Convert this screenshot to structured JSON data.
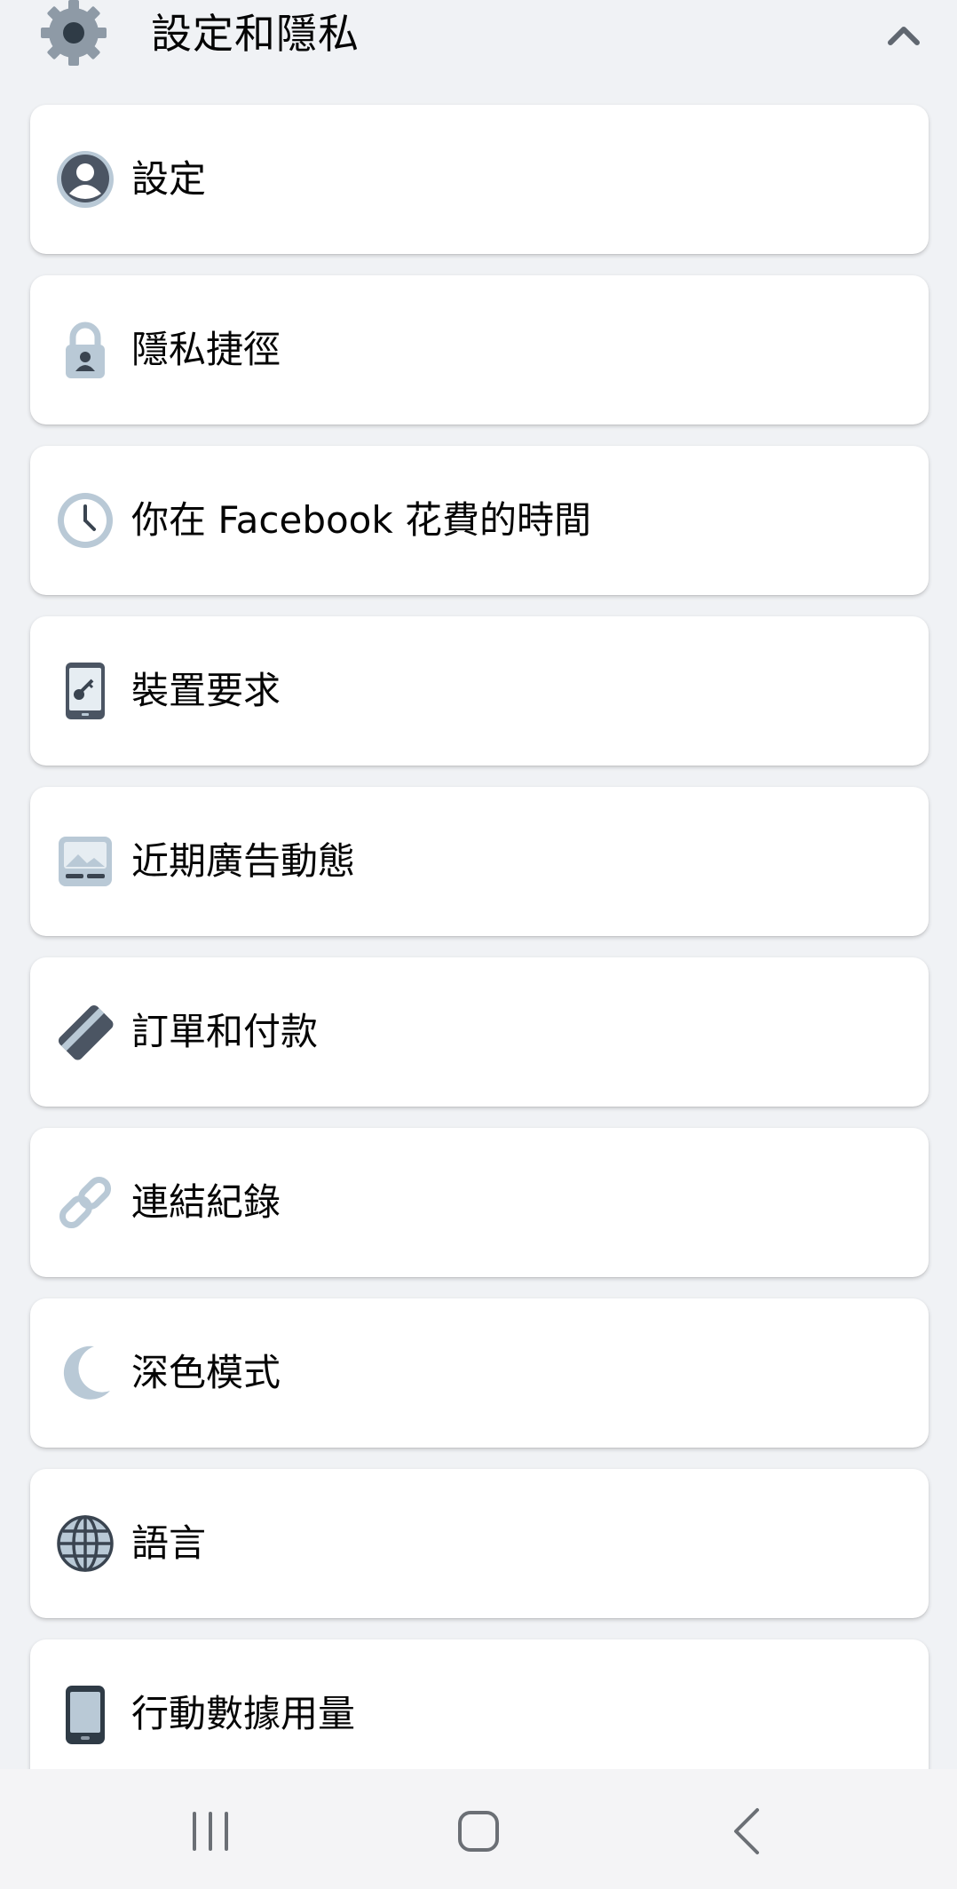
{
  "header": {
    "title": "設定和隱私",
    "icon": "gear-icon",
    "expand_icon": "chevron-up-icon"
  },
  "items": [
    {
      "label": "設定",
      "icon": "account-icon"
    },
    {
      "label": "隱私捷徑",
      "icon": "lock-icon"
    },
    {
      "label": "你在 Facebook 花費的時間",
      "icon": "clock-icon"
    },
    {
      "label": "裝置要求",
      "icon": "phone-key-icon"
    },
    {
      "label": "近期廣告動態",
      "icon": "ad-image-icon"
    },
    {
      "label": "訂單和付款",
      "icon": "card-icon"
    },
    {
      "label": "連結紀錄",
      "icon": "link-icon"
    },
    {
      "label": "深色模式",
      "icon": "moon-icon"
    },
    {
      "label": "語言",
      "icon": "globe-icon"
    },
    {
      "label": "行動數據用量",
      "icon": "phone-icon"
    }
  ],
  "navbar": {
    "buttons": [
      "recent-apps-icon",
      "home-icon",
      "back-icon"
    ]
  },
  "colors": {
    "background": "#f0f2f5",
    "card": "#ffffff",
    "icon_dark": "#4b5563",
    "icon_light": "#b9c9d6"
  }
}
